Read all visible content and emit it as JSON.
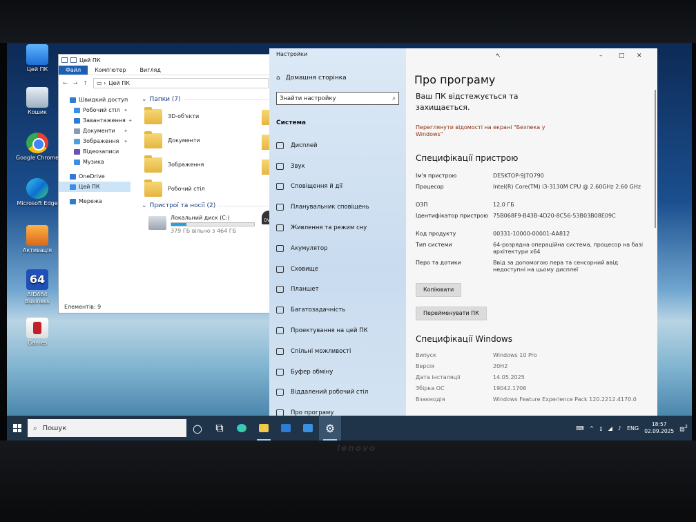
{
  "hardware": {
    "brand": "lenovo"
  },
  "desktop": {
    "icons": [
      {
        "label": "Цей ПК",
        "icon": "computer-icon"
      },
      {
        "label": "Кошик",
        "icon": "recycle-bin-icon"
      },
      {
        "label": "Google Chrome",
        "icon": "chrome-icon"
      },
      {
        "label": "Microsoft Edge",
        "icon": "edge-icon"
      },
      {
        "label": "Активація",
        "icon": "activation-icon"
      },
      {
        "label": "AIDA64 Business",
        "icon": "aida64-icon"
      },
      {
        "label": "Games",
        "icon": "games-icon"
      }
    ],
    "aida_badge": "64"
  },
  "explorer": {
    "title": "Цей ПК",
    "tabs": [
      "Файл",
      "Комп'ютер",
      "Вигляд"
    ],
    "address": "Цей ПК",
    "nav": [
      {
        "label": "Швидкий доступ",
        "pinned": false,
        "color": "#2e7bd6"
      },
      {
        "label": "Робочий стіл",
        "pinned": true,
        "color": "#3a8ee6"
      },
      {
        "label": "Завантаження",
        "pinned": true,
        "color": "#2e7bd6"
      },
      {
        "label": "Документи",
        "pinned": true,
        "color": "#8a9bb0"
      },
      {
        "label": "Зображення",
        "pinned": true,
        "color": "#4aa3df"
      },
      {
        "label": "Відеозаписи",
        "pinned": false,
        "color": "#6c4fb0"
      },
      {
        "label": "Музика",
        "pinned": false,
        "color": "#3a8ee6"
      },
      {
        "label": "OneDrive",
        "pinned": false,
        "color": "#2e7bd6"
      },
      {
        "label": "Цей ПК",
        "pinned": false,
        "color": "#3a8ee6"
      },
      {
        "label": "Мережа",
        "pinned": false,
        "color": "#2e7bd6"
      }
    ],
    "folders_group": "Папки (7)",
    "folders": [
      "3D-об'єкти",
      "Документи",
      "Зображення",
      "Робочий стіл"
    ],
    "devices_group": "Пристрої та носії (2)",
    "drive": {
      "name": "Локальний диск (C:)",
      "free": "379 ГБ вільно з 464 ГБ",
      "used_fraction": 0.18
    },
    "dvd_label": "DVD",
    "status": "Елементів: 9"
  },
  "settings": {
    "app_title": "Настройки",
    "home": "Домашня сторінка",
    "search_placeholder": "Знайти настройку",
    "section": "Система",
    "nav": [
      {
        "label": "Дисплей",
        "icon": "display-icon"
      },
      {
        "label": "Звук",
        "icon": "sound-icon"
      },
      {
        "label": "Сповіщення й дії",
        "icon": "notifications-icon"
      },
      {
        "label": "Планувальник сповіщень",
        "icon": "focus-assist-icon"
      },
      {
        "label": "Живлення та режим сну",
        "icon": "power-icon"
      },
      {
        "label": "Акумулятор",
        "icon": "battery-icon"
      },
      {
        "label": "Сховище",
        "icon": "storage-icon"
      },
      {
        "label": "Планшет",
        "icon": "tablet-icon"
      },
      {
        "label": "Багатозадачність",
        "icon": "multitasking-icon"
      },
      {
        "label": "Проектування на цей ПК",
        "icon": "projecting-icon"
      },
      {
        "label": "Спільні можливості",
        "icon": "shared-experiences-icon"
      },
      {
        "label": "Буфер обміну",
        "icon": "clipboard-icon"
      },
      {
        "label": "Віддалений робочий стіл",
        "icon": "remote-desktop-icon"
      },
      {
        "label": "Про програму",
        "icon": "about-icon"
      }
    ],
    "page_title": "Про програму",
    "protection": "Ваш ПК відстежується та захищається.",
    "security_link": "Переглянути відомості на екрані \"Безпека у Windows\"",
    "device_specs_title": "Специфікації пристрою",
    "device_specs": [
      {
        "k": "Ім'я пристрою",
        "v": "DESKTOP-9J7O790"
      },
      {
        "k": "Процесор",
        "v": "Intel(R) Core(TM) i3-3130M CPU @ 2.60GHz   2.60 GHz"
      },
      {
        "k": "ОЗП",
        "v": "12,0 ГБ"
      },
      {
        "k": "Ідентифікатор пристрою",
        "v": "75B068F9-B43B-4D20-8C56-53B03B08E09C"
      },
      {
        "k": "Код продукту",
        "v": "00331-10000-00001-AA812"
      },
      {
        "k": "Тип системи",
        "v": "64-розрядна операційна система, процесор на базі архітектури x64"
      },
      {
        "k": "Перо та дотики",
        "v": "Ввід за допомогою пера та сенсорний ввід недоступні на цьому дисплеї"
      }
    ],
    "copy_button": "Копіювати",
    "rename_button": "Перейменувати ПК",
    "windows_specs_title": "Специфікації Windows",
    "windows_specs": [
      {
        "k": "Випуск",
        "v": "Windows 10 Pro"
      },
      {
        "k": "Версія",
        "v": "20H2"
      },
      {
        "k": "Дата інсталяції",
        "v": "14.05.2025"
      },
      {
        "k": "Збірка ОС",
        "v": "19042.1706"
      },
      {
        "k": "Взаємодія",
        "v": "Windows Feature Experience Pack 120.2212.4170.0"
      }
    ],
    "window_controls": {
      "minimize": "–",
      "maximize": "□",
      "close": "✕"
    }
  },
  "taskbar": {
    "search_placeholder": "Пошук",
    "lang": "ENG",
    "time": "18:57",
    "date": "02.09.2025",
    "notification_count": "2"
  }
}
